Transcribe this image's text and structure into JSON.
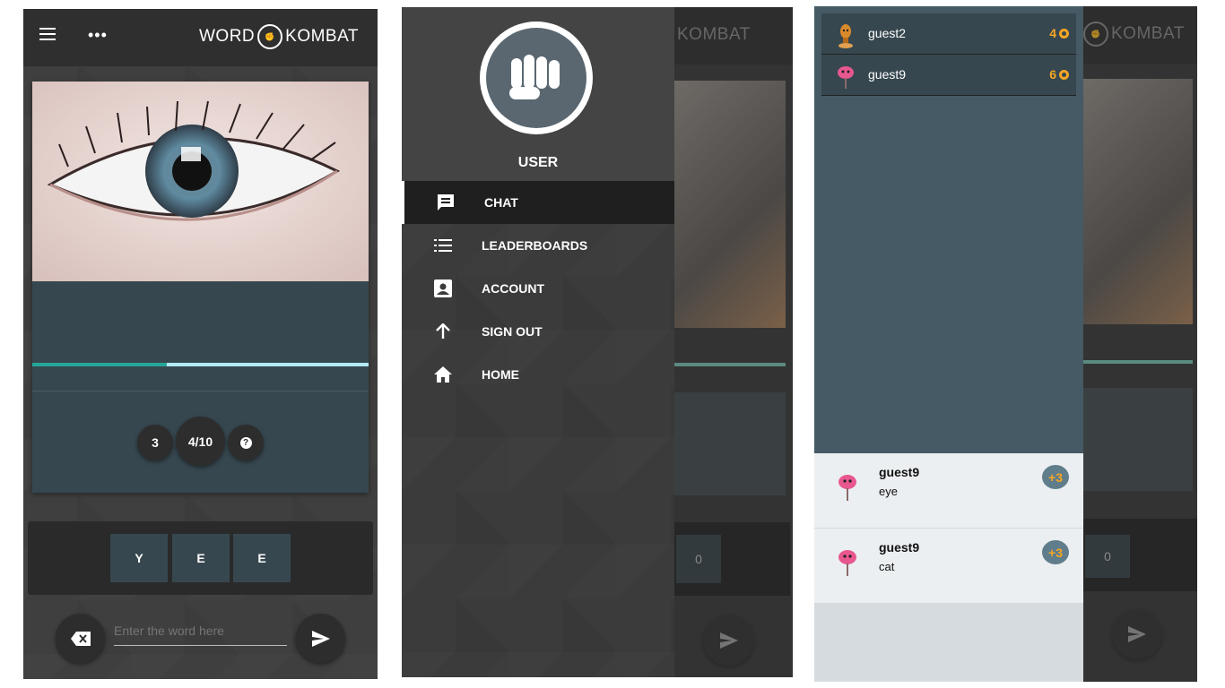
{
  "app": {
    "logo_left": "WORD",
    "logo_right": "KOMBAT"
  },
  "game": {
    "progress": 0.4,
    "word_count": "3",
    "round": "4/10",
    "help_glyph": "?",
    "tiles": [
      "Y",
      "E",
      "E"
    ],
    "input_placeholder": "Enter the word here"
  },
  "drawer": {
    "username": "USER",
    "items": [
      {
        "label": "CHAT",
        "icon": "chat-icon",
        "active": true
      },
      {
        "label": "LEADERBOARDS",
        "icon": "list-icon",
        "active": false
      },
      {
        "label": "ACCOUNT",
        "icon": "account-box-icon",
        "active": false
      },
      {
        "label": "SIGN OUT",
        "icon": "arrow-up-icon",
        "active": false
      },
      {
        "label": "HOME",
        "icon": "home-icon",
        "active": false
      }
    ],
    "background_tile": "0"
  },
  "leaderboard": {
    "players": [
      {
        "name": "guest2",
        "score": "4"
      },
      {
        "name": "guest9",
        "score": "6"
      }
    ]
  },
  "chat": {
    "messages": [
      {
        "user": "guest9",
        "text": "eye",
        "points": "+3"
      },
      {
        "user": "guest9",
        "text": "cat",
        "points": "+3"
      }
    ],
    "background_tile": "0"
  },
  "colors": {
    "accent": "#26a69a",
    "accent_light": "#b2ebf2",
    "score": "#f5a623",
    "card": "#37474f"
  }
}
